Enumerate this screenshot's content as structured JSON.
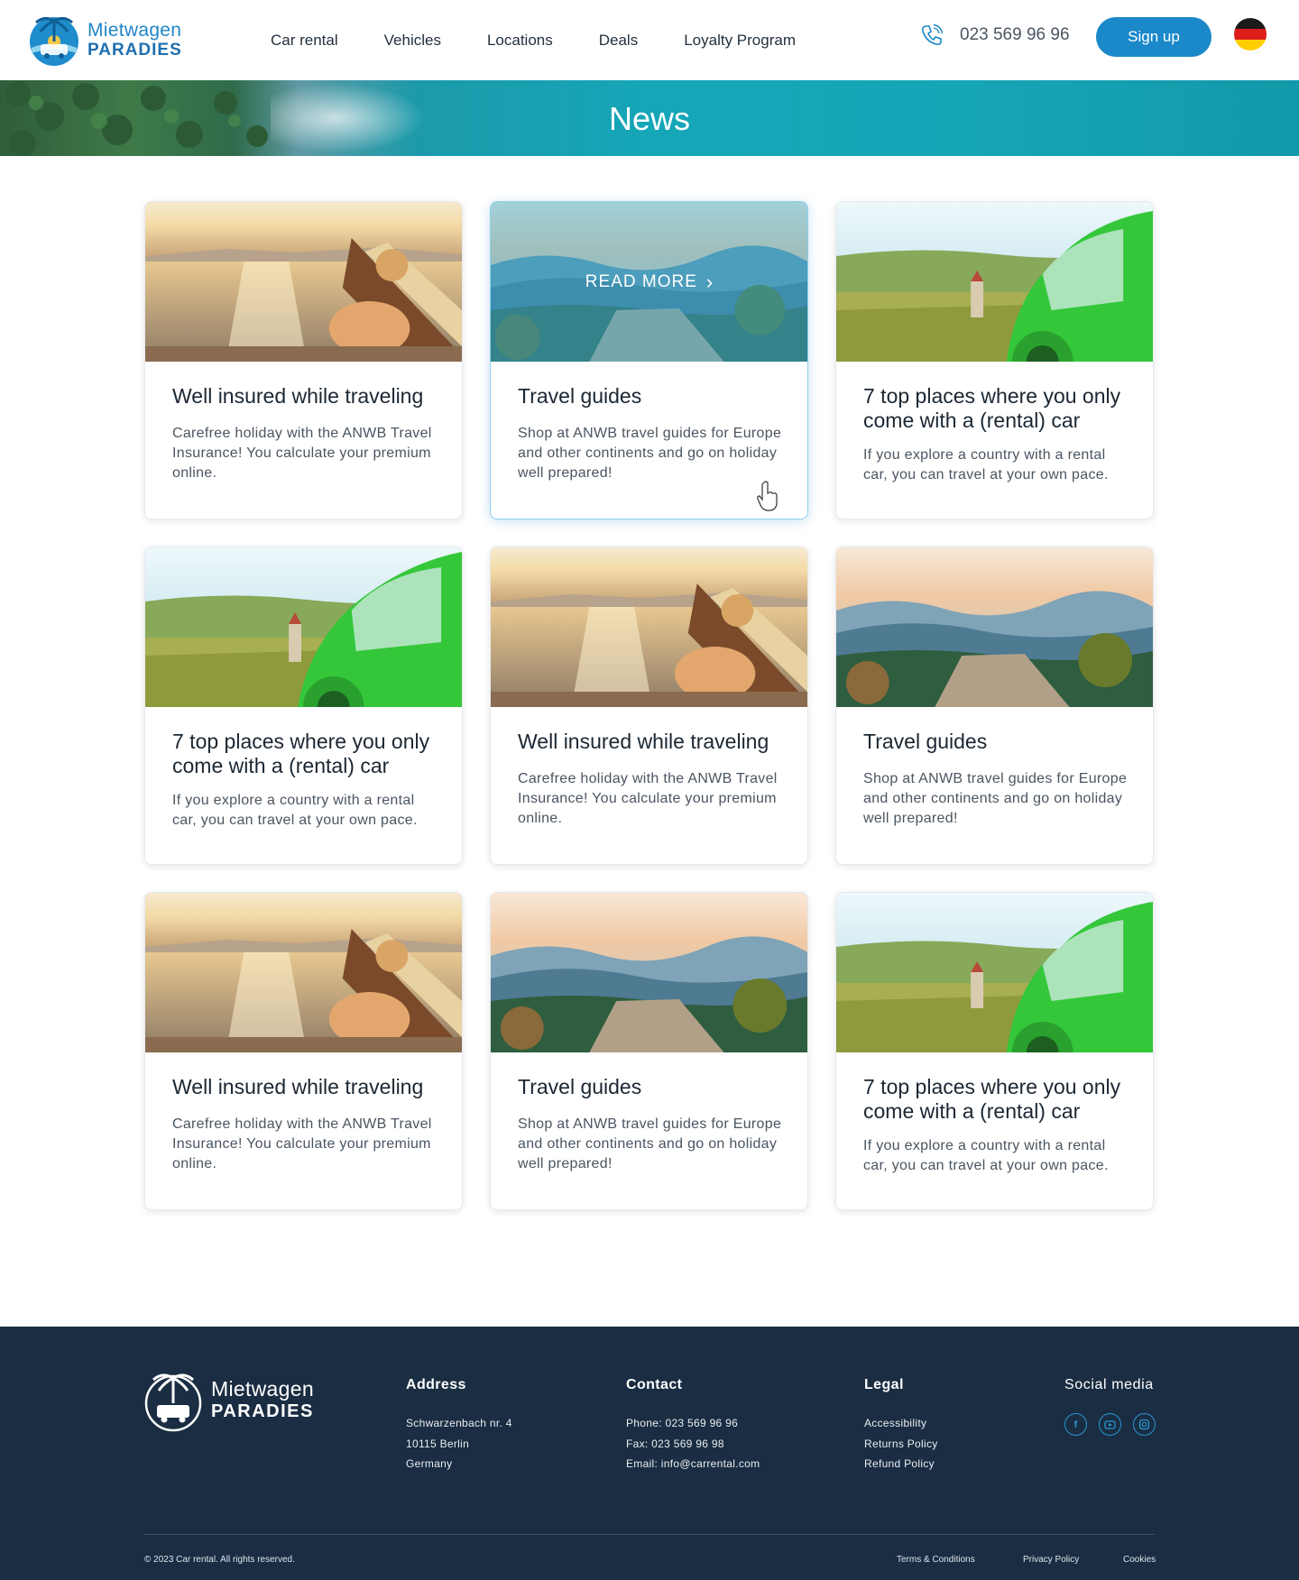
{
  "brand": {
    "line1": "Mietwagen",
    "line2": "PARADIES"
  },
  "nav": [
    "Car rental",
    "Vehicles",
    "Locations",
    "Deals",
    "Loyalty Program"
  ],
  "header": {
    "phone": "023 569 96 96",
    "signup": "Sign up",
    "language_flag": "germany-flag-icon"
  },
  "hero": {
    "title": "News"
  },
  "cards": [
    {
      "title": "Well insured while traveling",
      "text": "Carefree holiday with the ANWB Travel Insurance! You calculate your premium online.",
      "image": "beach-sunset"
    },
    {
      "title": "Travel guides",
      "text": "Shop at ANWB travel guides for Europe and other continents and go on holiday well prepared!",
      "image": "mountain-view",
      "hover_label": "READ MORE"
    },
    {
      "title": "7 top places where you only come with a (rental) car",
      "text": "If you explore a country with a rental car, you can travel at your own pace.",
      "image": "green-car"
    },
    {
      "title": "7 top places where you only come with a (rental) car",
      "text": "If you explore a country with a rental car, you can travel at your own pace.",
      "image": "green-car"
    },
    {
      "title": "Well insured while traveling",
      "text": "Carefree holiday with the ANWB Travel Insurance! You calculate your premium online.",
      "image": "beach-sunset"
    },
    {
      "title": "Travel guides",
      "text": "Shop at ANWB travel guides for Europe and other continents and go on holiday well prepared!",
      "image": "mountain-view"
    },
    {
      "title": "Well insured while traveling",
      "text": "Carefree holiday with the ANWB Travel Insurance! You calculate your premium online.",
      "image": "beach-sunset"
    },
    {
      "title": "Travel guides",
      "text": "Shop at ANWB travel guides for Europe and other continents and go on holiday well prepared!",
      "image": "mountain-view"
    },
    {
      "title": "7 top places where you only come with a (rental) car",
      "text": "If you explore a country with a rental car, you can travel at your own pace.",
      "image": "green-car"
    }
  ],
  "footer": {
    "address": {
      "title": "Address",
      "lines": [
        "Schwarzenbach nr. 4",
        "10115 Berlin",
        "Germany"
      ]
    },
    "contact": {
      "title": "Contact",
      "lines": [
        "Phone: 023 569 96 96",
        "Fax: 023 569 96 98",
        "Email: info@carrental.com"
      ]
    },
    "legal": {
      "title": "Legal",
      "lines": [
        "Accessibility",
        "Returns Policy",
        "Refund Policy"
      ]
    },
    "social": {
      "title": "Social media",
      "icons": [
        "facebook-icon",
        "youtube-icon",
        "instagram-icon"
      ]
    },
    "copyright": "© 2023 Car rental. All rights reserved.",
    "bottom_links": [
      "Terms & Conditions",
      "Privacy Policy",
      "Cookies"
    ]
  },
  "colors": {
    "accent": "#1a88c9",
    "footer_bg": "#1a2d42",
    "hero_sea": "#15a6b8"
  }
}
